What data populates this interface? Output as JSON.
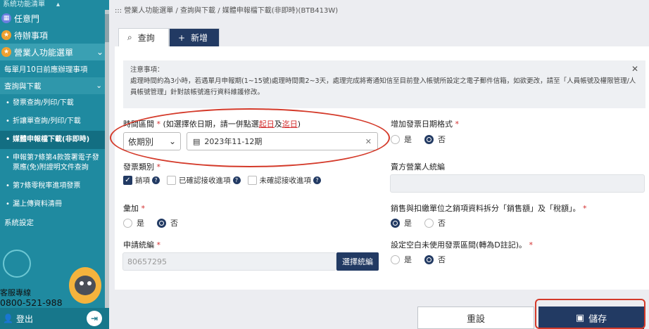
{
  "sidebar": {
    "top_label": "系統功能清單",
    "items": [
      {
        "label": "任意門",
        "icon": "map-icon"
      },
      {
        "label": "待辦事項",
        "icon": "star-icon"
      }
    ],
    "section": {
      "label": "營業人功能選單"
    },
    "sub1": {
      "label": "每單月10日前應辦理事項"
    },
    "sub2": {
      "label": "查詢與下載"
    },
    "leaves": [
      "發票查詢/列印/下載",
      "折讓單查詢/列印/下載",
      "媒體申報檔下載(非即時)",
      "申報第7條第4款簽署電子發票應(免)附證明文件查詢",
      "第7條零稅率進項發票",
      "漏上傳資料清冊"
    ],
    "sub3": {
      "label": "系統設定"
    },
    "hotline_label": "客服專線",
    "hotline_number": "0800-521-988",
    "logout_label": "登出"
  },
  "breadcrumb": "::: 營業人功能選單 / 查詢與下載 / 媒體申報檔下載(非即時)(BTB413W)",
  "tabs": {
    "query": "查詢",
    "add": "新增"
  },
  "notice": {
    "title": "注意事項：",
    "body": "處理時間約為3小時，若遇單月申報期(1~15號)處理時間需2~3天，處理完成將寄通知信至目前登入帳號所設定之電子郵件信箱，如欲更改，請至「人員帳號及權限管理/人員帳號管理」針對該帳號進行資料維護修改。"
  },
  "form": {
    "period_label": "時間區間",
    "period_hint_a": "(如選擇依日期，請一併點選",
    "period_hint_start": "起日",
    "period_hint_and": "及",
    "period_hint_end": "迄日",
    "period_hint_close": ")",
    "period_select": "依期別",
    "period_value": "2023年11-12期",
    "add_date_label": "增加發票日期格式",
    "yes": "是",
    "no": "否",
    "invoice_type_label": "發票類別",
    "sales_label": "銷項",
    "confirmed_label": "已確認接收進項",
    "unconfirmed_label": "未確認接收進項",
    "seller_id_label": "賣方營業人統編",
    "stack_label": "彙加",
    "split_label": "銷售與扣繳單位之銷項資料拆分「銷售額」及「稅額」。",
    "apply_id_label": "申請統編",
    "apply_id_value": "80657295",
    "pick_id_button": "選擇統編",
    "blank_label": "設定空白未使用發票區間(轉為D註記)。"
  },
  "buttons": {
    "reset": "重設",
    "save": "儲存"
  },
  "colors": {
    "sidebar": "#1f8aa0",
    "primary": "#223a63",
    "highlight": "#d43a2a"
  }
}
